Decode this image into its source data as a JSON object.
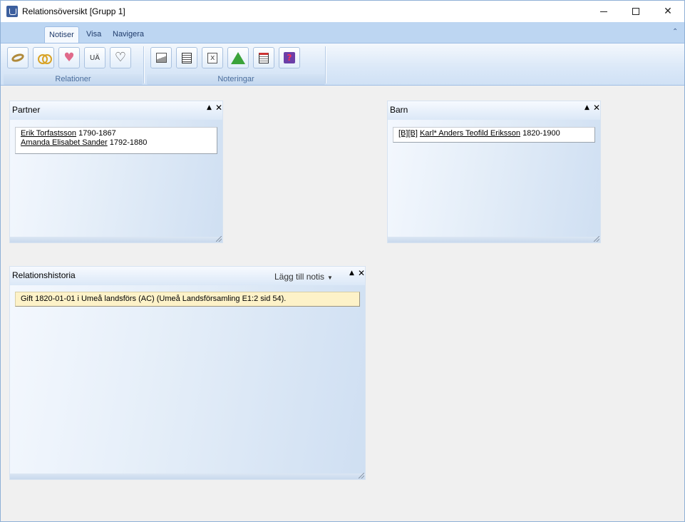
{
  "window": {
    "title": "Relationsöversikt [Grupp 1]",
    "minimize": "—",
    "close": "✕"
  },
  "ribbon": {
    "tabs": [
      {
        "label": "Notiser",
        "active": true
      },
      {
        "label": "Visa",
        "active": false
      },
      {
        "label": "Navigera",
        "active": false
      }
    ],
    "collapse_icon": "chevron-up-icon",
    "groups": {
      "relationer": {
        "label": "Relationer",
        "buttons": [
          {
            "icon": "wedding-ring-icon"
          },
          {
            "icon": "gold-rings-icon"
          },
          {
            "icon": "heart-icon"
          },
          {
            "icon": "ua-icon",
            "text": "UÄ"
          },
          {
            "icon": "broken-heart-icon"
          }
        ]
      },
      "noteringar": {
        "label": "Noteringar",
        "buttons": [
          {
            "icon": "picture-icon"
          },
          {
            "icon": "document-icon"
          },
          {
            "icon": "document-x-icon"
          },
          {
            "icon": "warning-icon"
          },
          {
            "icon": "note-icon"
          },
          {
            "icon": "help-icon"
          }
        ]
      }
    }
  },
  "panels": {
    "partner": {
      "title": "Partner",
      "rows": [
        {
          "name": "Erik Torfastsson",
          "years": "1790-1867"
        },
        {
          "name": "Amanda Elisabet Sander",
          "years": "1792-1880"
        }
      ]
    },
    "barn": {
      "title": "Barn",
      "rows": [
        {
          "prefix": "[B][B]",
          "name": "Karl* Anders Teofild Eriksson",
          "years": "1820-1900"
        }
      ]
    },
    "relationshistoria": {
      "title": "Relationshistoria",
      "add_note_label": "Lägg till notis",
      "notes": [
        "Gift 1820-01-01 i Umeå landsförs (AC) (Umeå Landsförsamling E1:2 sid  54)."
      ]
    }
  },
  "colors": {
    "ribbon_tab_bar": "#bdd6f2",
    "panel_gradient_end": "#cfdff2",
    "note_background": "#fdf2c8"
  }
}
